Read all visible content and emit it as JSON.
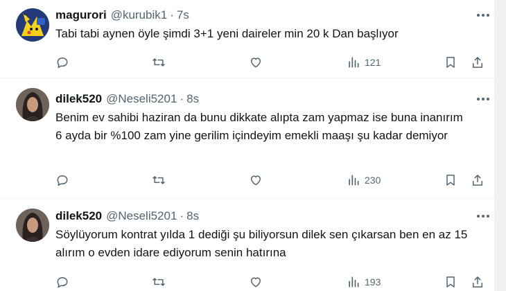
{
  "tweets": [
    {
      "name": "magurori",
      "handle": "@kurubik1",
      "time": "7s",
      "text": "Tabi tabi aynen öyle şimdi 3+1 yeni daireler min 20 k Dan başlıyor",
      "views": "121",
      "avatar_icon": "pikachu-avatar"
    },
    {
      "name": "dilek520",
      "handle": "@Neseli5201",
      "time": "8s",
      "text": "Benim ev sahibi haziran da bunu dikkate alıpta zam yapmaz ise buna inanırım 6 ayda bir %100 zam yine gerilim içindeyim emekli maaşı şu kadar demiyor",
      "views": "230",
      "avatar_icon": "woman-avatar"
    },
    {
      "name": "dilek520",
      "handle": "@Neseli5201",
      "time": "8s",
      "text": "Söylüyorum kontrat yılda 1 dediği şu biliyorsun dilek sen çıkarsan ben en az 15 alırım o evden idare ediyorum senin hatırına",
      "views": "193",
      "avatar_icon": "woman-avatar"
    }
  ],
  "separator": "·",
  "colors": {
    "text": "#0f1419",
    "secondary": "#536471",
    "divider": "#eff3f4"
  }
}
